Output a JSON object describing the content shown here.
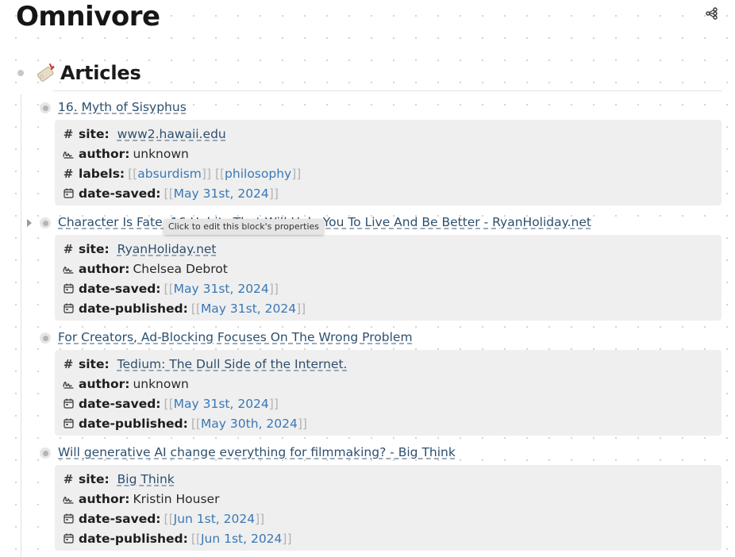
{
  "page": {
    "title": "Omnivore"
  },
  "section": {
    "title": "Articles",
    "emoji": "tag-icon"
  },
  "tooltip": "Click to edit this block's properties",
  "articles": [
    {
      "title": "16. Myth of Sisyphus",
      "site": "www2.hawaii.edu",
      "author": "unknown",
      "labels": [
        "absurdism",
        "philosophy"
      ],
      "date_saved": "May 31st, 2024",
      "date_published": null
    },
    {
      "title": "Character Is Fate: 16 Habits That Will Help You To Live And Be Better - RyanHoliday.net",
      "site": "RyanHoliday.net",
      "author": "Chelsea Debrot",
      "labels": null,
      "date_saved": "May 31st, 2024",
      "date_published": "May 31st, 2024"
    },
    {
      "title": "For Creators, Ad-Blocking Focuses On The Wrong Problem",
      "site": "Tedium: The Dull Side of the Internet.",
      "author": "unknown",
      "labels": null,
      "date_saved": "May 31st, 2024",
      "date_published": "May 30th, 2024"
    },
    {
      "title": "Will generative AI change everything for filmmaking? - Big Think",
      "site": "Big Think",
      "author": "Kristin Houser",
      "labels": null,
      "date_saved": "Jun 1st, 2024",
      "date_published": "Jun 1st, 2024"
    }
  ],
  "property_keys": {
    "site": "site:",
    "author": "author:",
    "labels": "labels:",
    "date_saved": "date-saved:",
    "date_published": "date-published:"
  },
  "brackets": {
    "open": "[[",
    "close": "]]"
  },
  "icons": {
    "hash": "#",
    "author": "signature-icon",
    "date": "calendar-icon",
    "graph": "graph-view-icon"
  }
}
